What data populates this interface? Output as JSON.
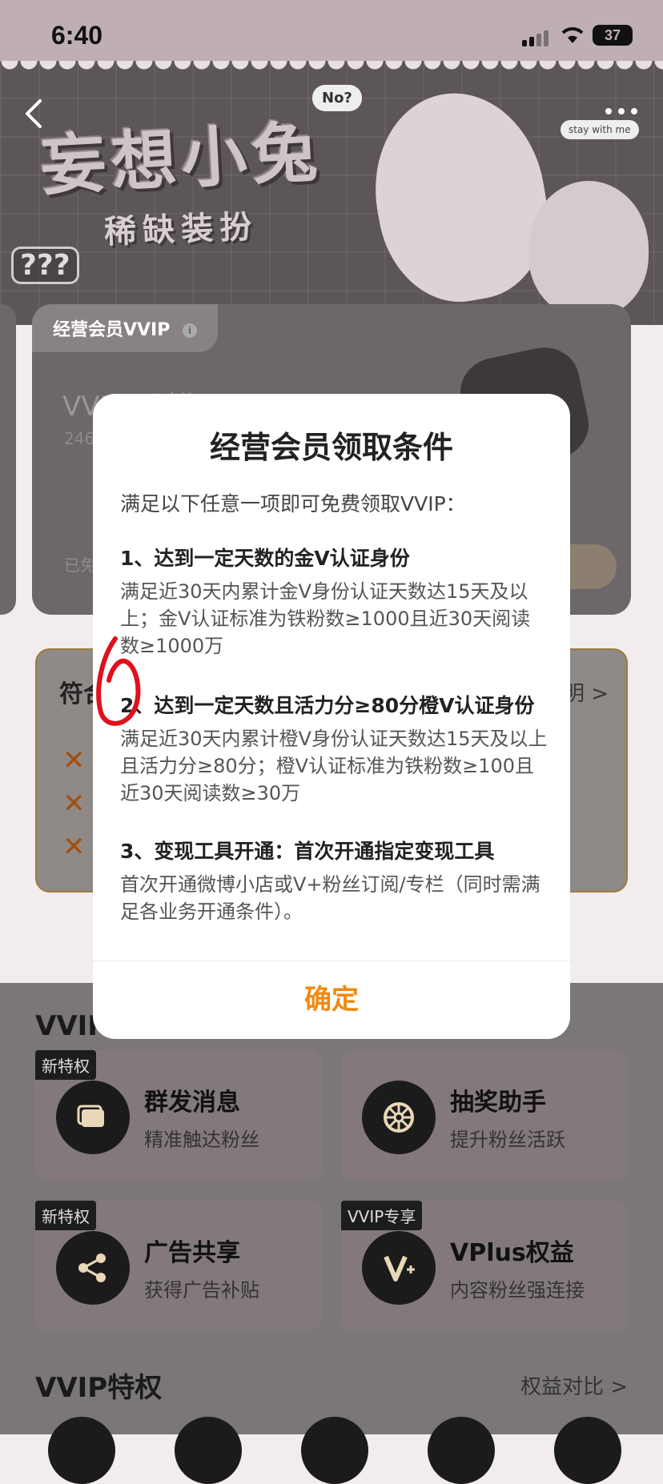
{
  "status_bar": {
    "time": "6:40",
    "battery": "37"
  },
  "banner": {
    "title": "妄想小兔",
    "subtitle": "稀缺装扮",
    "bubble_no": "No?",
    "bubble_stay": "stay with me",
    "question_tag": "???"
  },
  "member_card": {
    "tag": "经营会员VVIP",
    "status": "VVIP已过期",
    "id_text": "246",
    "claimed_text": "已免"
  },
  "condition_card": {
    "title": "符合",
    "link": "明 >"
  },
  "sections": {
    "vvip_title_partial": "VVIP",
    "vvip_title": "VVIP特权",
    "compare_link": "权益对比 >",
    "privileges": [
      {
        "badge": "新特权",
        "title": "群发消息",
        "subtitle": "精准触达粉丝",
        "icon": "message-icon"
      },
      {
        "badge": "",
        "title": "抽奖助手",
        "subtitle": "提升粉丝活跃",
        "icon": "wheel-icon"
      },
      {
        "badge": "新特权",
        "title": "广告共享",
        "subtitle": "获得广告补贴",
        "icon": "share-icon"
      },
      {
        "badge": "VVIP专享",
        "title": "VPlus权益",
        "subtitle": "内容粉丝强连接",
        "icon": "vplus-icon"
      }
    ]
  },
  "modal": {
    "title": "经营会员领取条件",
    "intro": "满足以下任意一项即可免费领取VVIP：",
    "conditions": [
      {
        "heading": "1、达到一定天数的金V认证身份",
        "body": "满足近30天内累计金V身份认证天数达15天及以上；金V认证标准为铁粉数≥1000且近30天阅读数≥1000万"
      },
      {
        "heading": "2、达到一定天数且活力分≥80分橙V认证身份",
        "body": "满足近30天内累计橙V身份认证天数达15天及以上且活力分≥80分；橙V认证标准为铁粉数≥100且近30天阅读数≥30万"
      },
      {
        "heading": "3、变现工具开通：首次开通指定变现工具",
        "body": "首次开通微博小店或V+粉丝订阅/专栏（同时需满足各业务开通条件）。"
      }
    ],
    "confirm_label": "确定"
  },
  "colors": {
    "accent": "#f08a12",
    "overlay": "#7b7779"
  }
}
